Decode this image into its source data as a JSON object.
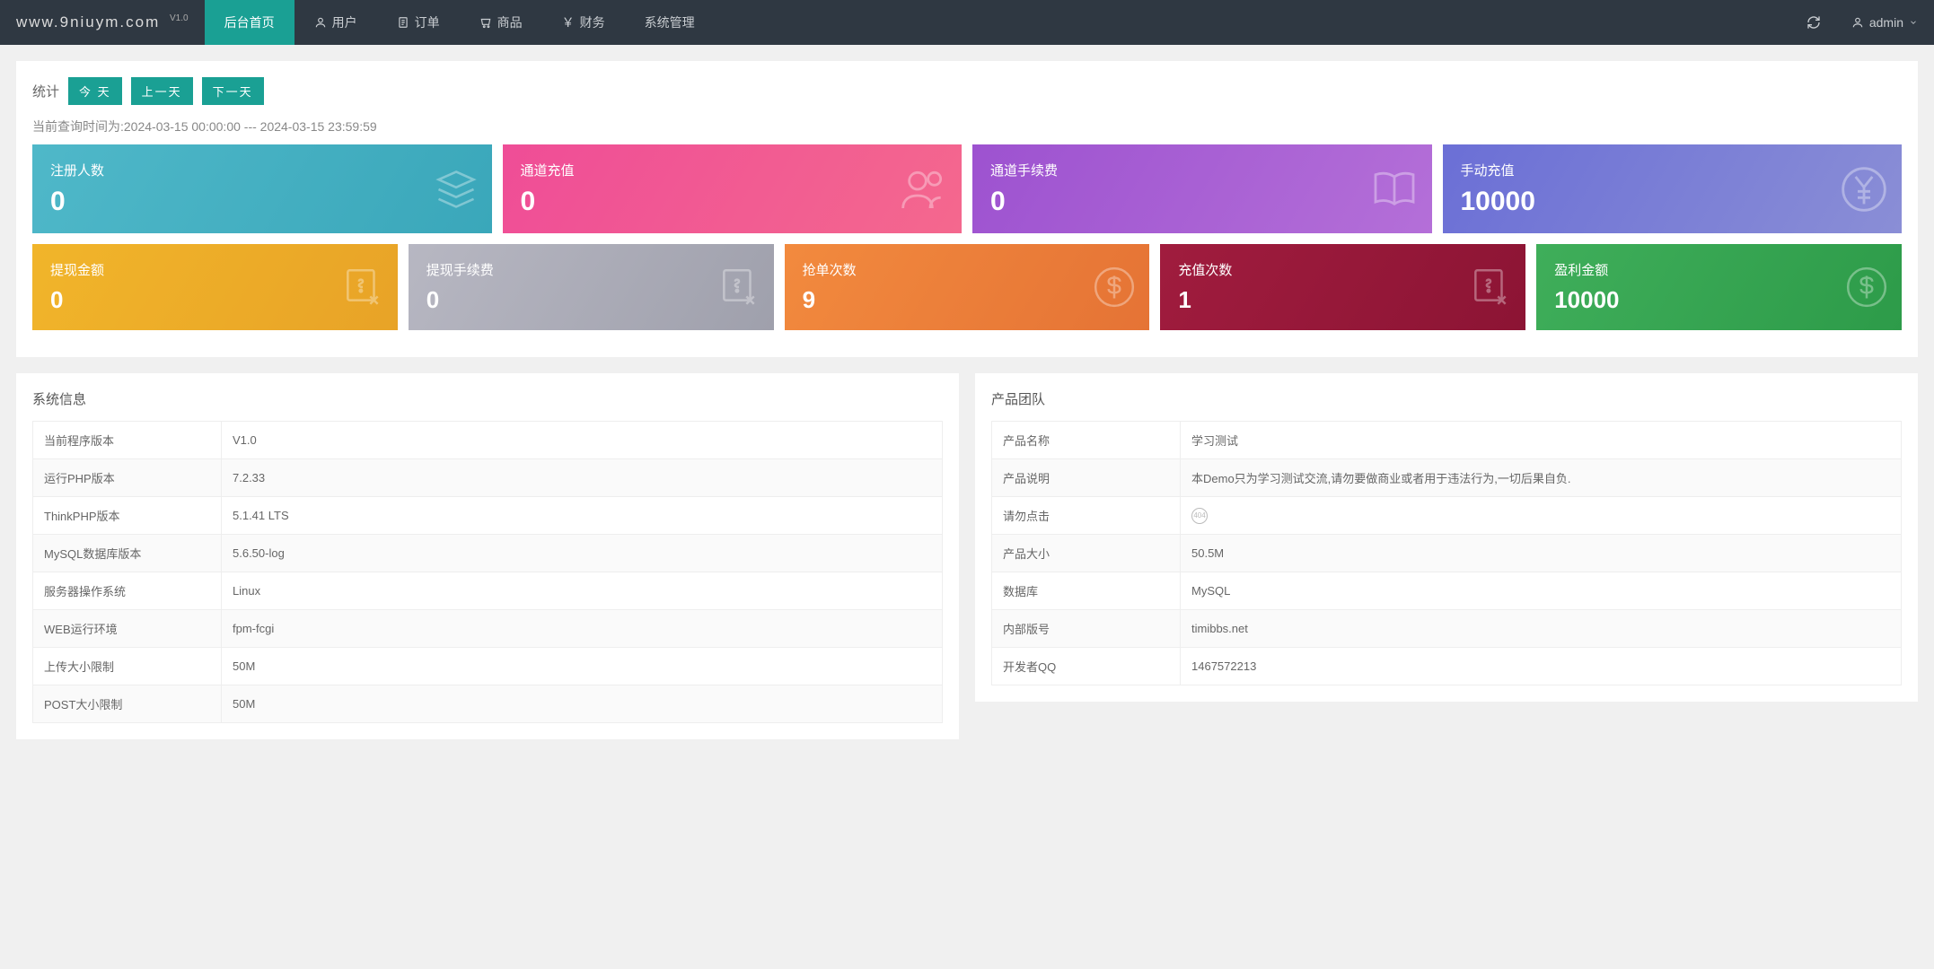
{
  "brand": {
    "name": "www.9niuym.com",
    "version": "V1.0"
  },
  "nav": [
    {
      "label": "后台首页",
      "icon": "",
      "active": true
    },
    {
      "label": "用户",
      "icon": "user",
      "active": false
    },
    {
      "label": "订单",
      "icon": "order",
      "active": false
    },
    {
      "label": "商品",
      "icon": "cart",
      "active": false
    },
    {
      "label": "财务",
      "icon": "yen",
      "active": false
    },
    {
      "label": "系统管理",
      "icon": "",
      "active": false
    }
  ],
  "user": {
    "name": "admin"
  },
  "stats": {
    "title": "统计",
    "buttons": {
      "today": "今 天",
      "prev": "上一天",
      "next": "下一天"
    },
    "query_time_label": "当前查询时间为:2024-03-15 00:00:00 --- 2024-03-15 23:59:59",
    "top": [
      {
        "label": "注册人数",
        "value": "0",
        "color": "c-blue",
        "icon": "layers"
      },
      {
        "label": "通道充值",
        "value": "0",
        "color": "c-pink",
        "icon": "people"
      },
      {
        "label": "通道手续费",
        "value": "0",
        "color": "c-purple",
        "icon": "book"
      },
      {
        "label": "手动充值",
        "value": "10000",
        "color": "c-indigo",
        "icon": "yen-o"
      }
    ],
    "bottom": [
      {
        "label": "提现金额",
        "value": "0",
        "color": "c-yellow",
        "icon": "note"
      },
      {
        "label": "提现手续费",
        "value": "0",
        "color": "c-gray",
        "icon": "note"
      },
      {
        "label": "抢单次数",
        "value": "9",
        "color": "c-orange",
        "icon": "dollar"
      },
      {
        "label": "充值次数",
        "value": "1",
        "color": "c-red",
        "icon": "note"
      },
      {
        "label": "盈利金额",
        "value": "10000",
        "color": "c-green",
        "icon": "dollar"
      }
    ]
  },
  "sysinfo": {
    "title": "系统信息",
    "rows": [
      {
        "k": "当前程序版本",
        "v": "V1.0"
      },
      {
        "k": "运行PHP版本",
        "v": "7.2.33"
      },
      {
        "k": "ThinkPHP版本",
        "v": "5.1.41 LTS"
      },
      {
        "k": "MySQL数据库版本",
        "v": "5.6.50-log"
      },
      {
        "k": "服务器操作系统",
        "v": "Linux"
      },
      {
        "k": "WEB运行环境",
        "v": "fpm-fcgi"
      },
      {
        "k": "上传大小限制",
        "v": "50M"
      },
      {
        "k": "POST大小限制",
        "v": "50M"
      }
    ]
  },
  "team": {
    "title": "产品团队",
    "rows": [
      {
        "k": "产品名称",
        "v": "学习测试"
      },
      {
        "k": "产品说明",
        "v": "本Demo只为学习测试交流,请勿要做商业或者用于违法行为,一切后果自负."
      },
      {
        "k": "请勿点击",
        "v": "",
        "badge": "404"
      },
      {
        "k": "产品大小",
        "v": "50.5M"
      },
      {
        "k": "数据库",
        "v": "MySQL"
      },
      {
        "k": "内部版号",
        "v": "timibbs.net"
      },
      {
        "k": "开发者QQ",
        "v": "1467572213"
      }
    ]
  }
}
